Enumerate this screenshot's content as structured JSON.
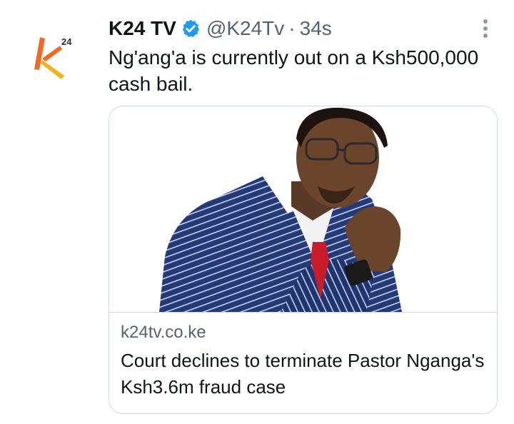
{
  "author": {
    "name": "K24 TV",
    "handle": "@K24Tv",
    "separator": "·",
    "time": "34s",
    "avatar_text": "24",
    "avatar_icon": "k24-logo-icon",
    "verified_icon": "verified-badge-icon"
  },
  "tweet": {
    "text": "Ng'ang'a is currently out on a Ksh500,000 cash bail."
  },
  "link_card": {
    "domain": "k24tv.co.ke",
    "title": "Court declines to terminate Pastor Nganga's Ksh3.6m fraud case",
    "image_icon": "pastor-photo-image"
  },
  "colors": {
    "verified": "#1d9bf0",
    "secondary_text": "#536471",
    "border": "#cfd9de",
    "logo_orange": "#f26a21",
    "logo_yellow": "#f6b01a"
  }
}
